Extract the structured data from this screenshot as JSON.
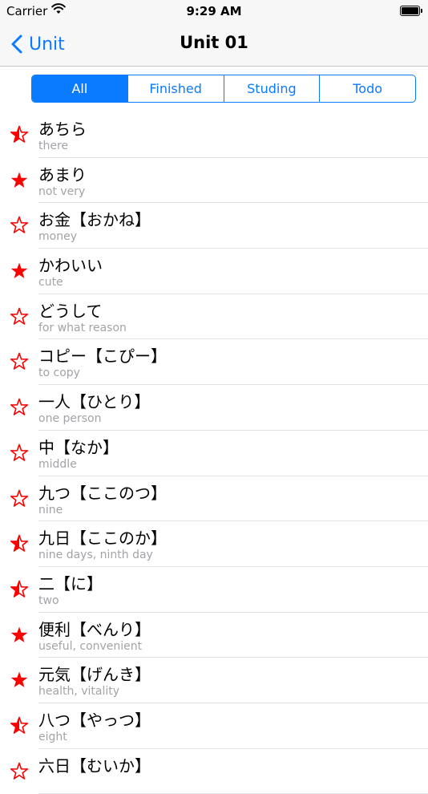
{
  "status_bar": {
    "carrier": "Carrier",
    "time": "9:29 AM"
  },
  "nav": {
    "back_label": "Unit",
    "title": "Unit 01"
  },
  "colors": {
    "accent": "#0a7aff",
    "star": "#ff0000"
  },
  "segments": [
    {
      "label": "All",
      "active": true
    },
    {
      "label": "Finished",
      "active": false
    },
    {
      "label": "Studing",
      "active": false
    },
    {
      "label": "Todo",
      "active": false
    }
  ],
  "items": [
    {
      "word": "あちら",
      "meaning": "there",
      "star": "half"
    },
    {
      "word": "あまり",
      "meaning": "not very",
      "star": "full"
    },
    {
      "word": "お金【おかね】",
      "meaning": "money",
      "star": "empty"
    },
    {
      "word": "かわいい",
      "meaning": "cute",
      "star": "full"
    },
    {
      "word": "どうして",
      "meaning": "for what reason",
      "star": "empty"
    },
    {
      "word": "コピー【こぴー】",
      "meaning": "to copy",
      "star": "empty"
    },
    {
      "word": "一人【ひとり】",
      "meaning": "one person",
      "star": "empty"
    },
    {
      "word": "中【なか】",
      "meaning": "middle",
      "star": "empty"
    },
    {
      "word": "九つ【ここのつ】",
      "meaning": "nine",
      "star": "empty"
    },
    {
      "word": "九日【ここのか】",
      "meaning": "nine days, ninth day",
      "star": "half"
    },
    {
      "word": "二【に】",
      "meaning": "two",
      "star": "half"
    },
    {
      "word": "便利【べんり】",
      "meaning": "useful, convenient",
      "star": "full"
    },
    {
      "word": "元気【げんき】",
      "meaning": "health, vitality",
      "star": "full"
    },
    {
      "word": "八つ【やっつ】",
      "meaning": "eight",
      "star": "half"
    },
    {
      "word": "六日【むいか】",
      "meaning": "",
      "star": "empty"
    }
  ]
}
